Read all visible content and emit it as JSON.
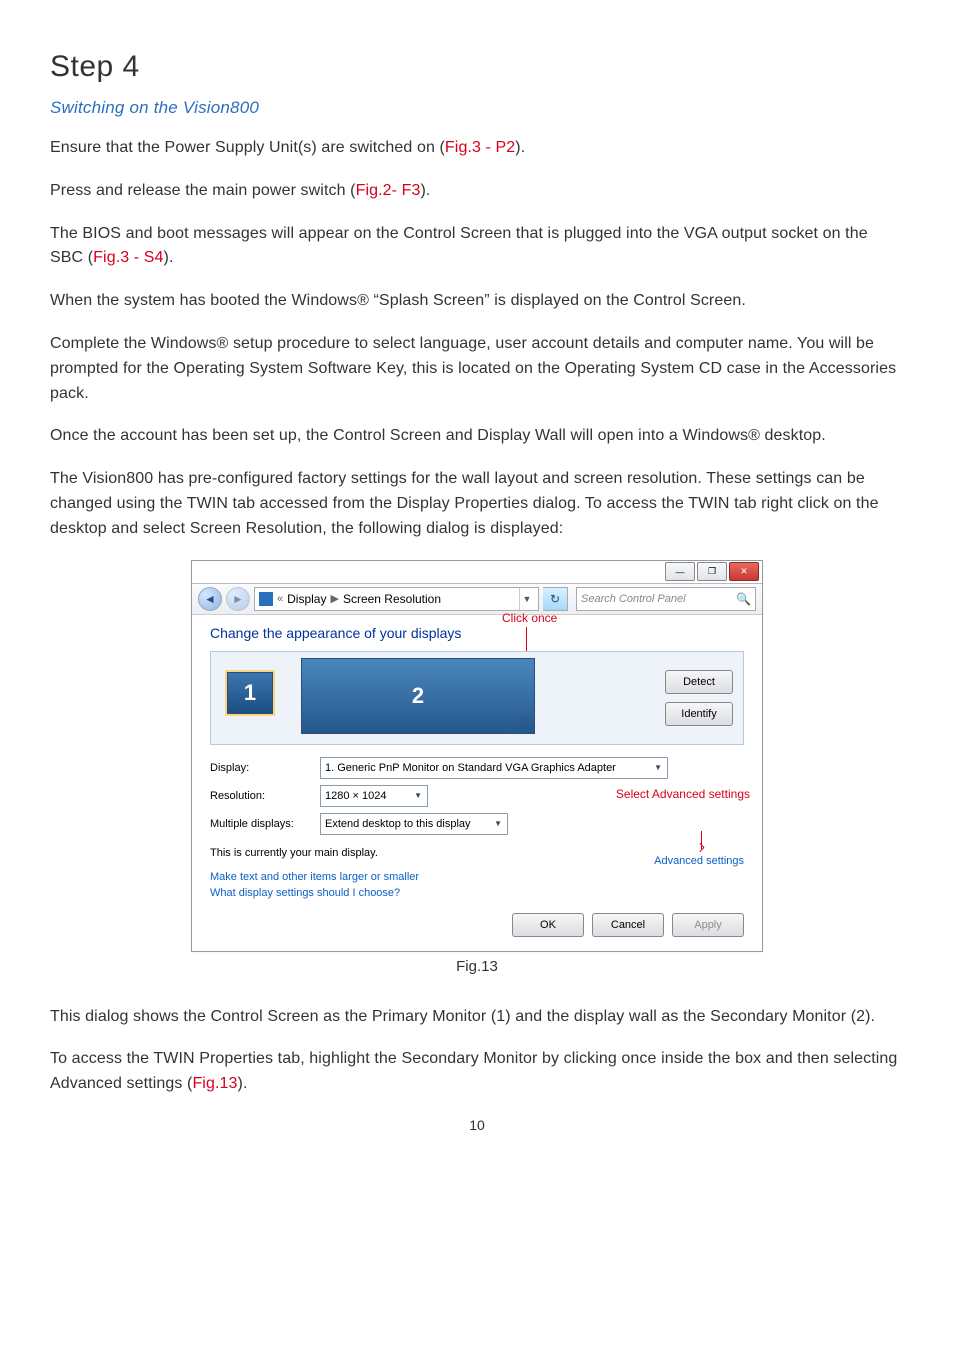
{
  "step_heading": "Step 4",
  "subtitle": "Switching on the Vision800",
  "para": {
    "p1a": "Ensure that the Power Supply Unit(s) are switched on (",
    "p1ref": "Fig.3 - P2",
    "p1b": ").",
    "p2a": "Press and release the main power switch (",
    "p2ref": "Fig.2-  F3",
    "p2b": ").",
    "p3a": "The BIOS and boot messages will appear on the Control Screen that is plugged into the VGA output socket on the SBC (",
    "p3ref": "Fig.3 - S4",
    "p3b": ").",
    "p4": "When the system has booted the Windows® “Splash Screen” is displayed on the Control Screen.",
    "p5": "Complete the Windows® setup procedure to select language, user account details and computer name.  You will be prompted for the Operating System Software Key, this is located on the Operating System CD case in the Accessories pack.",
    "p6": "Once the account has been set up, the Control Screen and Display Wall will open into a Windows® desktop.",
    "p7": "The Vision800 has pre-configured factory settings for the wall layout and screen resolution.  These settings can be changed using the TWIN tab accessed from the Display Properties dialog. To access the TWIN tab right click on the desktop and select Screen Resolution, the following dialog is displayed:",
    "p8": "This dialog shows the Control Screen as the Primary Monitor (1) and the display wall as the Secondary Monitor (2).",
    "p9a": "To access the TWIN Properties tab, highlight the Secondary Monitor by clicking once inside the box and then selecting Advanced settings (",
    "p9ref": "Fig.13",
    "p9b": ")."
  },
  "fig_caption": "Fig.13",
  "page_number": "10",
  "dialog": {
    "win_min": "—",
    "win_max": "❐",
    "win_close": "✕",
    "bc_prefix": "«",
    "bc_display": "Display",
    "bc_sep": "▶",
    "bc_screenres": "Screen Resolution",
    "search_placeholder": "Search Control Panel",
    "title": "Change the appearance of your displays",
    "detect": "Detect",
    "identify": "Identify",
    "mon1": "1",
    "mon2": "2",
    "lbl_display": "Display:",
    "val_display": "1. Generic PnP Monitor on Standard VGA Graphics Adapter",
    "lbl_resolution": "Resolution:",
    "val_resolution": "1280 × 1024",
    "lbl_multi": "Multiple displays:",
    "val_multi": "Extend desktop to this display",
    "main_display": "This is currently your main display.",
    "advanced": "Advanced settings",
    "link1": "Make text and other items larger or smaller",
    "link2": "What display settings should I choose?",
    "ok": "OK",
    "cancel": "Cancel",
    "apply": "Apply"
  },
  "annotations": {
    "click_once": "Click once",
    "select_advanced": "Select Advanced settings"
  }
}
